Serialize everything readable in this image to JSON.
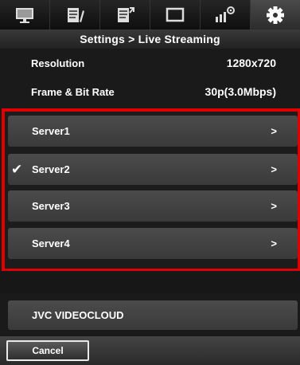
{
  "tabs": [
    {
      "icon": "monitor-icon"
    },
    {
      "icon": "edit-list-icon"
    },
    {
      "icon": "export-list-icon"
    },
    {
      "icon": "window-icon"
    },
    {
      "icon": "camera-settings-icon"
    },
    {
      "icon": "gear-icon",
      "active": true
    }
  ],
  "breadcrumb": "Settings > Live Streaming",
  "info": {
    "resolution_label": "Resolution",
    "resolution_value": "1280x720",
    "framerate_label": "Frame & Bit Rate",
    "framerate_value": "30p(3.0Mbps)"
  },
  "servers": [
    {
      "label": "Server1",
      "checked": false,
      "arrow": ">"
    },
    {
      "label": "Server2",
      "checked": true,
      "check_mark": "✔",
      "arrow": ">"
    },
    {
      "label": "Server3",
      "checked": false,
      "arrow": ">"
    },
    {
      "label": "Server4",
      "checked": false,
      "arrow": ">"
    }
  ],
  "highlight_color": "#e00000",
  "cloud_button": "JVC VIDEOCLOUD",
  "cancel_button": "Cancel"
}
